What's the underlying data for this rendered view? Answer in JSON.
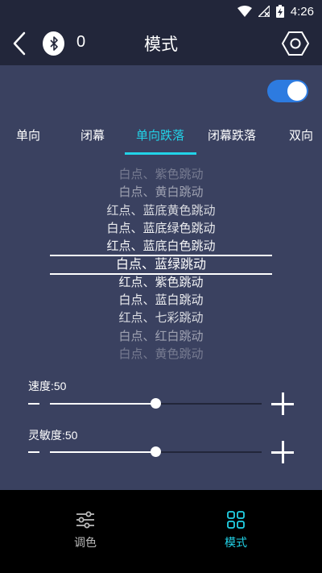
{
  "status": {
    "time": "4:26"
  },
  "header": {
    "bt_count": "0",
    "title": "模式"
  },
  "colors": {
    "accent": "#22d3e8",
    "toggle": "#2d7be0",
    "panel": "#3a4160",
    "bar": "#22263a"
  },
  "toggle": {
    "on": true
  },
  "tabs": [
    {
      "label": "单向",
      "active": false
    },
    {
      "label": "闭幕",
      "active": false
    },
    {
      "label": "单向跌落",
      "active": true
    },
    {
      "label": "闭幕跌落",
      "active": false
    },
    {
      "label": "双向",
      "active": false
    }
  ],
  "picker": {
    "items": [
      "白点、紫色跳动",
      "白点、黄白跳动",
      "红点、蓝底黄色跳动",
      "白点、蓝底绿色跳动",
      "红点、蓝底白色跳动",
      "白点、蓝绿跳动",
      "红点、紫色跳动",
      "白点、蓝白跳动",
      "红点、七彩跳动",
      "白点、红白跳动",
      "白点、黄色跳动"
    ],
    "selected_index": 5
  },
  "sliders": {
    "speed": {
      "label": "速度:50",
      "value": 50,
      "max": 100
    },
    "sensitivity": {
      "label": "灵敏度:50",
      "value": 50,
      "max": 100
    }
  },
  "nav": {
    "color": {
      "label": "调色"
    },
    "mode": {
      "label": "模式"
    }
  }
}
